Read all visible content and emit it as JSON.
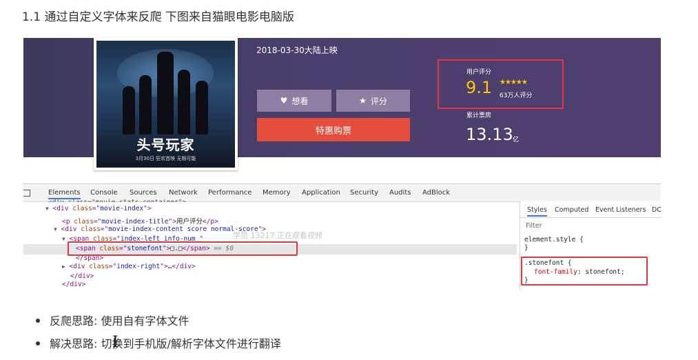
{
  "heading": "1.1 通过自定义字体来反爬 下图来自猫眼电影电脑版",
  "movie": {
    "poster_title": "头号玩家",
    "poster_subtitle": "3月30日 狂欢首映 无限可能",
    "release": "2018-03-30大陆上映",
    "want_label": "想看",
    "rate_label": "评分",
    "buy_label": "特惠购票",
    "rating_label": "用户评分",
    "rating_score": "9.1",
    "rating_stars": 5,
    "rating_count": "63万人评分",
    "box_office_label": "累计票房",
    "box_office_value": "13.13",
    "box_office_unit": "亿",
    "accent_color": "#e54e3d",
    "score_color": "#ffc600"
  },
  "devtools": {
    "tabs": [
      "Elements",
      "Console",
      "Sources",
      "Network",
      "Performance",
      "Memory",
      "Application",
      "Security",
      "Audits",
      "AdBlock"
    ],
    "active_tab": "Elements",
    "code": {
      "line0": "<div class=\"movie-stats-container\">",
      "l1_tag": "div",
      "l1_attr": "class",
      "l1_val": "movie-index",
      "l2_tag": "p",
      "l2_attr": "class",
      "l2_val": "movie-index-title",
      "l2_text": "用户评分",
      "l3_tag": "div",
      "l3_attr": "class",
      "l3_val": "movie-index-content score normal-score",
      "l4_tag": "span",
      "l4_attr": "class",
      "l4_val": "index-left info-num ",
      "l5_tag": "span",
      "l5_attr": "class",
      "l5_val": "stonefont",
      "l5_text": "□.□",
      "l5_suffix": "== $0",
      "l6_close": "</span>",
      "l7_tag": "div",
      "l7_attr": "class",
      "l7_val": "index-right",
      "l7_text": "…",
      "l8_close": "</div>",
      "l9_close": "</div>"
    },
    "watermark": "学员 13217 正在观看视频",
    "styles_tabs": [
      "Styles",
      "Computed",
      "Event Listeners",
      "DC"
    ],
    "filter_label": "Filter",
    "element_style": "element.style {",
    "rule_selector": ".stonefont {",
    "rule_property": "font-family",
    "rule_value": "stonefont;",
    "close_brace": "}"
  },
  "bullets": [
    "反爬思路: 使用自有字体文件",
    "解决思路: 切换到手机版/解析字体文件进行翻译"
  ]
}
